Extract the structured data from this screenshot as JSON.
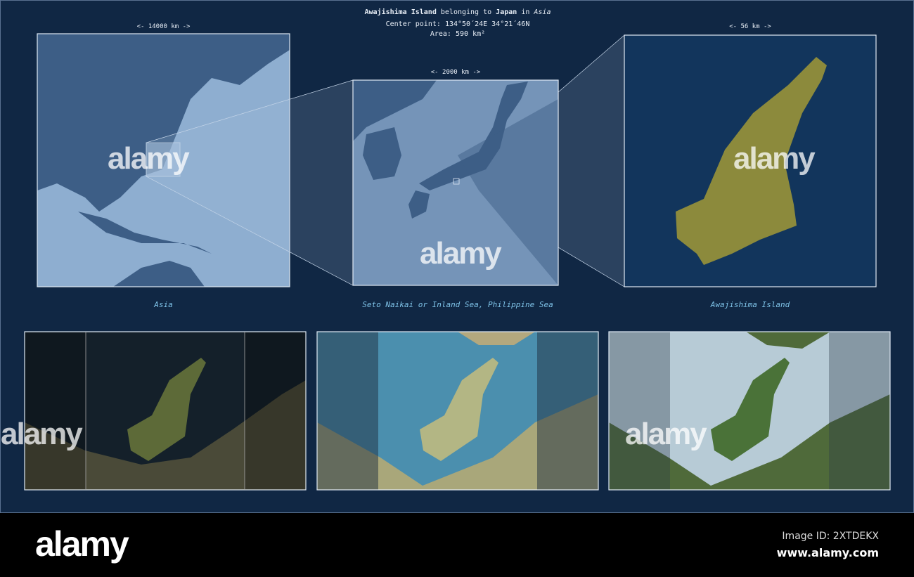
{
  "header": {
    "island": "Awajishima Island",
    "belonging": "belonging to",
    "country": "Japan",
    "in": "in",
    "continent": "Asia",
    "center_label": "Center point:",
    "center_value": "134°50´24E  34°21´46N",
    "area_label": "Area:",
    "area_value": "590 km²"
  },
  "panels": [
    {
      "scale": "<-   14000 km   ->",
      "caption": "Asia"
    },
    {
      "scale": "<-   2000 km   ->",
      "caption": "Seto Naikai or Inland Sea, Philippine Sea"
    },
    {
      "scale": "<-   56 km   ->",
      "caption": "Awajishima Island"
    }
  ],
  "colors": {
    "background": "#102744",
    "island": "#8c8a3c",
    "caption": "#7fc3e8"
  },
  "watermark": "alamy",
  "footer": {
    "logo": "alamy",
    "image_id": "Image ID: 2XTDEKX",
    "url": "www.alamy.com"
  }
}
